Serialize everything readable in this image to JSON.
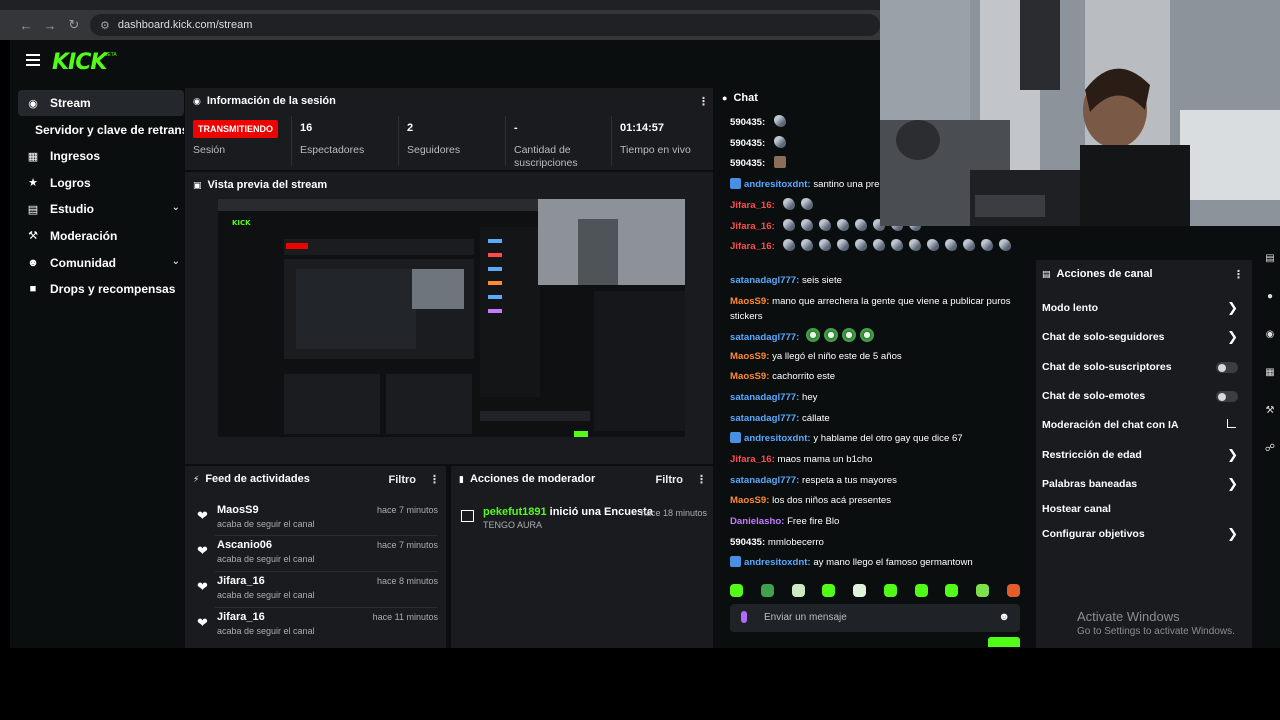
{
  "browser": {
    "url": "dashboard.kick.com/stream"
  },
  "brand": {
    "logo_text": "KICK",
    "logo_badge": "BETA",
    "accent": "#53fc18"
  },
  "sidebar": {
    "items": [
      {
        "label": "Stream",
        "icon": "broadcast-icon"
      },
      {
        "label": "Servidor y clave de retransmisión",
        "icon": ""
      },
      {
        "label": "Ingresos",
        "icon": "chart-icon"
      },
      {
        "label": "Logros",
        "icon": "trophy-icon"
      },
      {
        "label": "Estudio",
        "icon": "studio-icon"
      },
      {
        "label": "Moderación",
        "icon": "wrench-icon"
      },
      {
        "label": "Comunidad",
        "icon": "people-icon"
      },
      {
        "label": "Drops y recompensas",
        "icon": "gift-icon"
      }
    ]
  },
  "session": {
    "title": "Información de la sesión",
    "status_badge": "TRANSMITIENDO",
    "status_label": "Sesión",
    "viewers_value": "16",
    "viewers_label": "Espectadores",
    "followers_value": "2",
    "followers_label": "Seguidores",
    "subs_value": "-",
    "subs_label": "Cantidad de suscripciones",
    "uptime_value": "01:14:57",
    "uptime_label": "Tiempo en vivo"
  },
  "preview": {
    "title": "Vista previa del stream"
  },
  "feed": {
    "title": "Feed de actividades",
    "filter_label": "Filtro",
    "items": [
      {
        "name": "MaosS9",
        "desc": "acaba de seguir el canal",
        "time": "hace 7 minutos"
      },
      {
        "name": "Ascanio06",
        "desc": "acaba de seguir el canal",
        "time": "hace 7 minutos"
      },
      {
        "name": "Jifara_16",
        "desc": "acaba de seguir el canal",
        "time": "hace 8 minutos"
      },
      {
        "name": "Jifara_16",
        "desc": "acaba de seguir el canal",
        "time": "hace 11 minutos"
      }
    ]
  },
  "mod_actions": {
    "title": "Acciones de moderador",
    "filter_label": "Filtro",
    "items": [
      {
        "user": "pekefut1891",
        "action": "inició una Encuesta",
        "sub": "TENGO AURA",
        "time": "hace 18 minutos"
      }
    ]
  },
  "chat": {
    "title": "Chat",
    "placeholder": "Enviar un mensaje",
    "messages": [
      {
        "user": "590435:",
        "color": "#ffffff",
        "text": ""
      },
      {
        "user": "590435:",
        "color": "#ffffff",
        "text": ""
      },
      {
        "user": "590435:",
        "color": "#ffffff",
        "text": ""
      },
      {
        "user": "andresitoxdnt:",
        "color": "#5aa9ff",
        "text": "santino una pregu"
      },
      {
        "user": "Jifara_16:",
        "color": "#ff4d4d",
        "text": ""
      },
      {
        "user": "Jifara_16:",
        "color": "#ff4d4d",
        "text": ""
      },
      {
        "user": "Jifara_16:",
        "color": "#ff4d4d",
        "text": ""
      },
      {
        "user": "satanadagl777:",
        "color": "#5aa9ff",
        "text": "seis siete"
      },
      {
        "user": "MaosS9:",
        "color": "#ff8a33",
        "text": "mano que arrechera la gente que viene a publicar puros stickers"
      },
      {
        "user": "satanadagl777:",
        "color": "#5aa9ff",
        "text": ""
      },
      {
        "user": "MaosS9:",
        "color": "#ff8a33",
        "text": "ya llegó el niño este de 5 años"
      },
      {
        "user": "MaosS9:",
        "color": "#ff8a33",
        "text": "cachorrito este"
      },
      {
        "user": "satanadagl777:",
        "color": "#5aa9ff",
        "text": "hey"
      },
      {
        "user": "satanadagl777:",
        "color": "#5aa9ff",
        "text": "cállate"
      },
      {
        "user": "andresitoxdnt:",
        "color": "#5aa9ff",
        "text": "y hablame del otro gay que dice 67"
      },
      {
        "user": "Jifara_16:",
        "color": "#ff4d4d",
        "text": "maos mama un b1cho"
      },
      {
        "user": "satanadagl777:",
        "color": "#5aa9ff",
        "text": "respeta a tus mayores"
      },
      {
        "user": "MaosS9:",
        "color": "#ff8a33",
        "text": "los dos niños acá presentes"
      },
      {
        "user": "Danielasho:",
        "color": "#c57bff",
        "text": "Free fire Blo"
      },
      {
        "user": "590435:",
        "color": "#ffffff",
        "text": "mmlobecerro"
      },
      {
        "user": "andresitoxdnt:",
        "color": "#5aa9ff",
        "text": "ay mano llego el famoso germantown"
      }
    ]
  },
  "channel_actions": {
    "title": "Acciones de canal",
    "items": [
      {
        "label": "Modo lento",
        "control": "chevron"
      },
      {
        "label": "Chat de solo-seguidores",
        "control": "chevron"
      },
      {
        "label": "Chat de solo-suscriptores",
        "control": "toggle"
      },
      {
        "label": "Chat de solo-emotes",
        "control": "toggle"
      },
      {
        "label": "Moderación del chat con IA",
        "control": "external"
      },
      {
        "label": "Restricción de edad",
        "control": "chevron"
      },
      {
        "label": "Palabras baneadas",
        "control": "chevron"
      },
      {
        "label": "Hostear canal",
        "control": "none"
      },
      {
        "label": "Configurar objetivos",
        "control": "chevron"
      }
    ]
  },
  "windows_watermark": {
    "line1": "Activate Windows",
    "line2": "Go to Settings to activate Windows."
  }
}
